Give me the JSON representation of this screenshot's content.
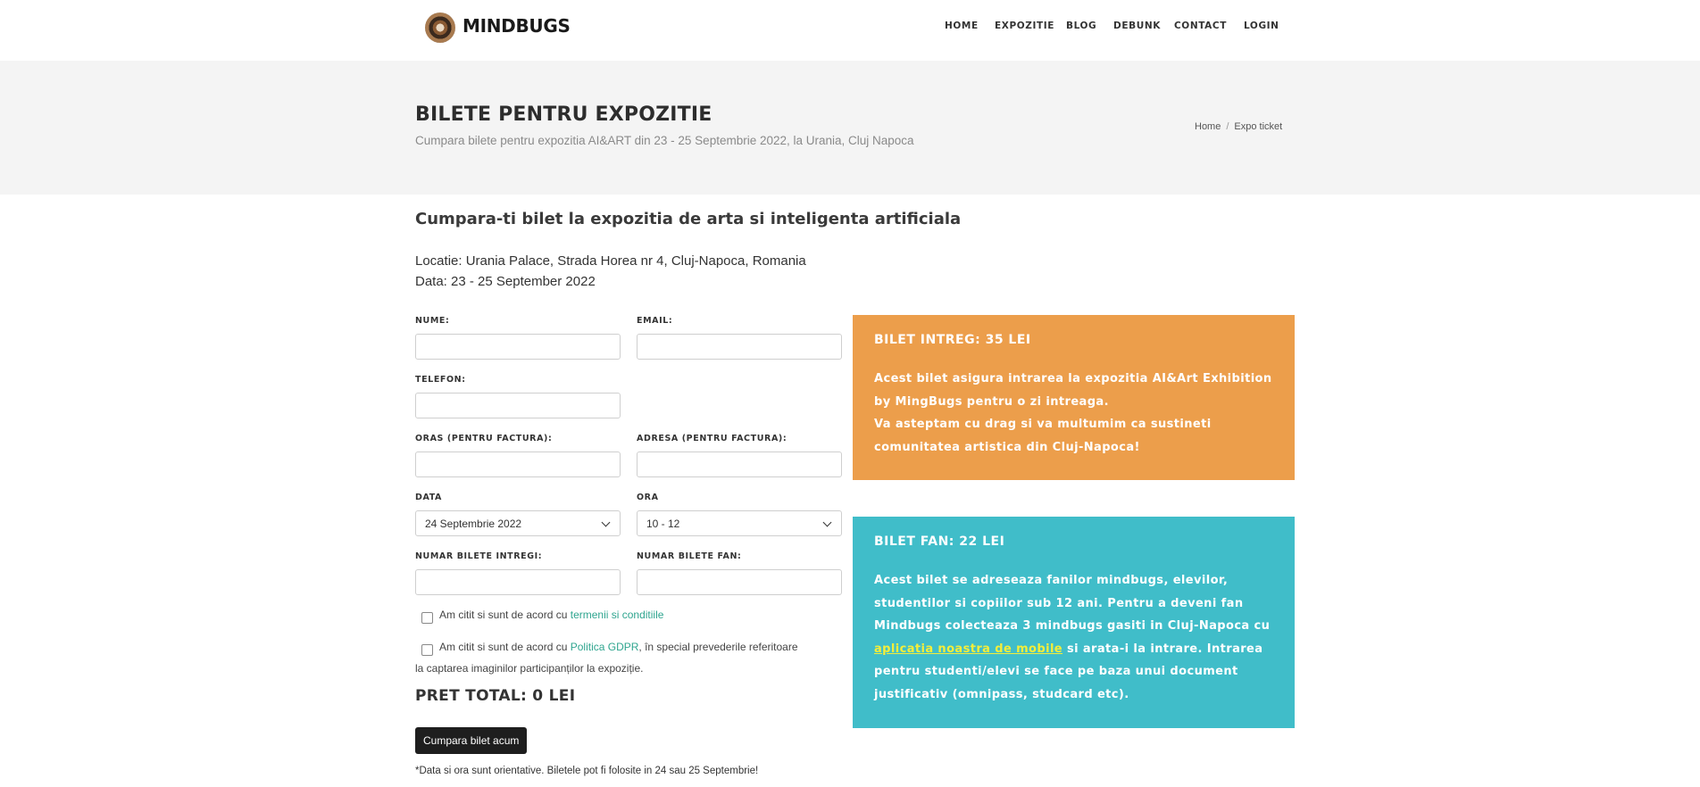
{
  "header": {
    "brand": "MINDBUGS",
    "nav": [
      "HOME",
      "EXPOZITIE",
      "BLOG",
      "DEBUNK",
      "CONTACT",
      "LOGIN"
    ]
  },
  "banner": {
    "title": "BILETE PENTRU EXPOZITIE",
    "subtitle": "Cumpara bilete pentru expozitia AI&ART din 23 - 25 Septembrie 2022, la Urania, Cluj Napoca",
    "breadcrumb": [
      "Home",
      "Expo ticket"
    ],
    "breadcrumb_sep": "/"
  },
  "content": {
    "heading": "Cumpara-ti bilet la expozitia de arta si inteligenta artificiala",
    "location": "Locatie: Urania Palace, Strada Horea nr 4, Cluj-Napoca, Romania",
    "date": "Data: 23 - 25 September 2022"
  },
  "form": {
    "name_label": "NUME:",
    "email_label": "EMAIL:",
    "phone_label": "TELEFON:",
    "city_label": "ORAS (PENTRU FACTURA):",
    "address_label": "ADRESA (PENTRU FACTURA):",
    "date_label": "DATA",
    "date_value": "24 Septembrie 2022",
    "time_label": "ORA",
    "time_value": "10 - 12",
    "full_tickets_label": "NUMAR BILETE INTREGI:",
    "fan_tickets_label": "NUMAR BILETE FAN:",
    "terms_prefix": "Am citit si sunt de acord cu ",
    "terms_link": "termenii si conditiile",
    "gdpr_prefix": "Am citit si sunt de acord cu ",
    "gdpr_link": "Politica GDPR",
    "gdpr_suffix": ", în special prevederile referitoare la captarea imaginilor participanților la expoziție.",
    "total": "PRET TOTAL: 0 LEI",
    "submit": "Cumpara bilet acum",
    "note": "*Data si ora sunt orientative. Biletele pot fi folosite in 24 sau 25 Septembrie!"
  },
  "tickets": {
    "full": {
      "title": "BILET INTREG: 35 LEI",
      "text1": "Acest bilet asigura intrarea la expozitia AI&Art Exhibition by MingBugs pentru o zi intreaga.",
      "text2": "Va asteptam cu drag si va multumim ca sustineti comunitatea artistica din Cluj-Napoca!",
      "color": "#ec9e4b"
    },
    "fan": {
      "title": "BILET FAN: 22 LEI",
      "text_before": "Acest bilet se adreseaza fanilor mindbugs, elevilor, studentilor si copiilor sub 12 ani. Pentru a deveni fan Mindbugs colecteaza 3 mindbugs gasiti in Cluj-Napoca cu ",
      "link": "aplicatia noastra de mobile",
      "text_after": " si arata-i la intrare. Intrarea pentru studenti/elevi se face pe baza unui document justificativ (omnipass, studcard etc).",
      "color": "#40bdc9"
    }
  }
}
